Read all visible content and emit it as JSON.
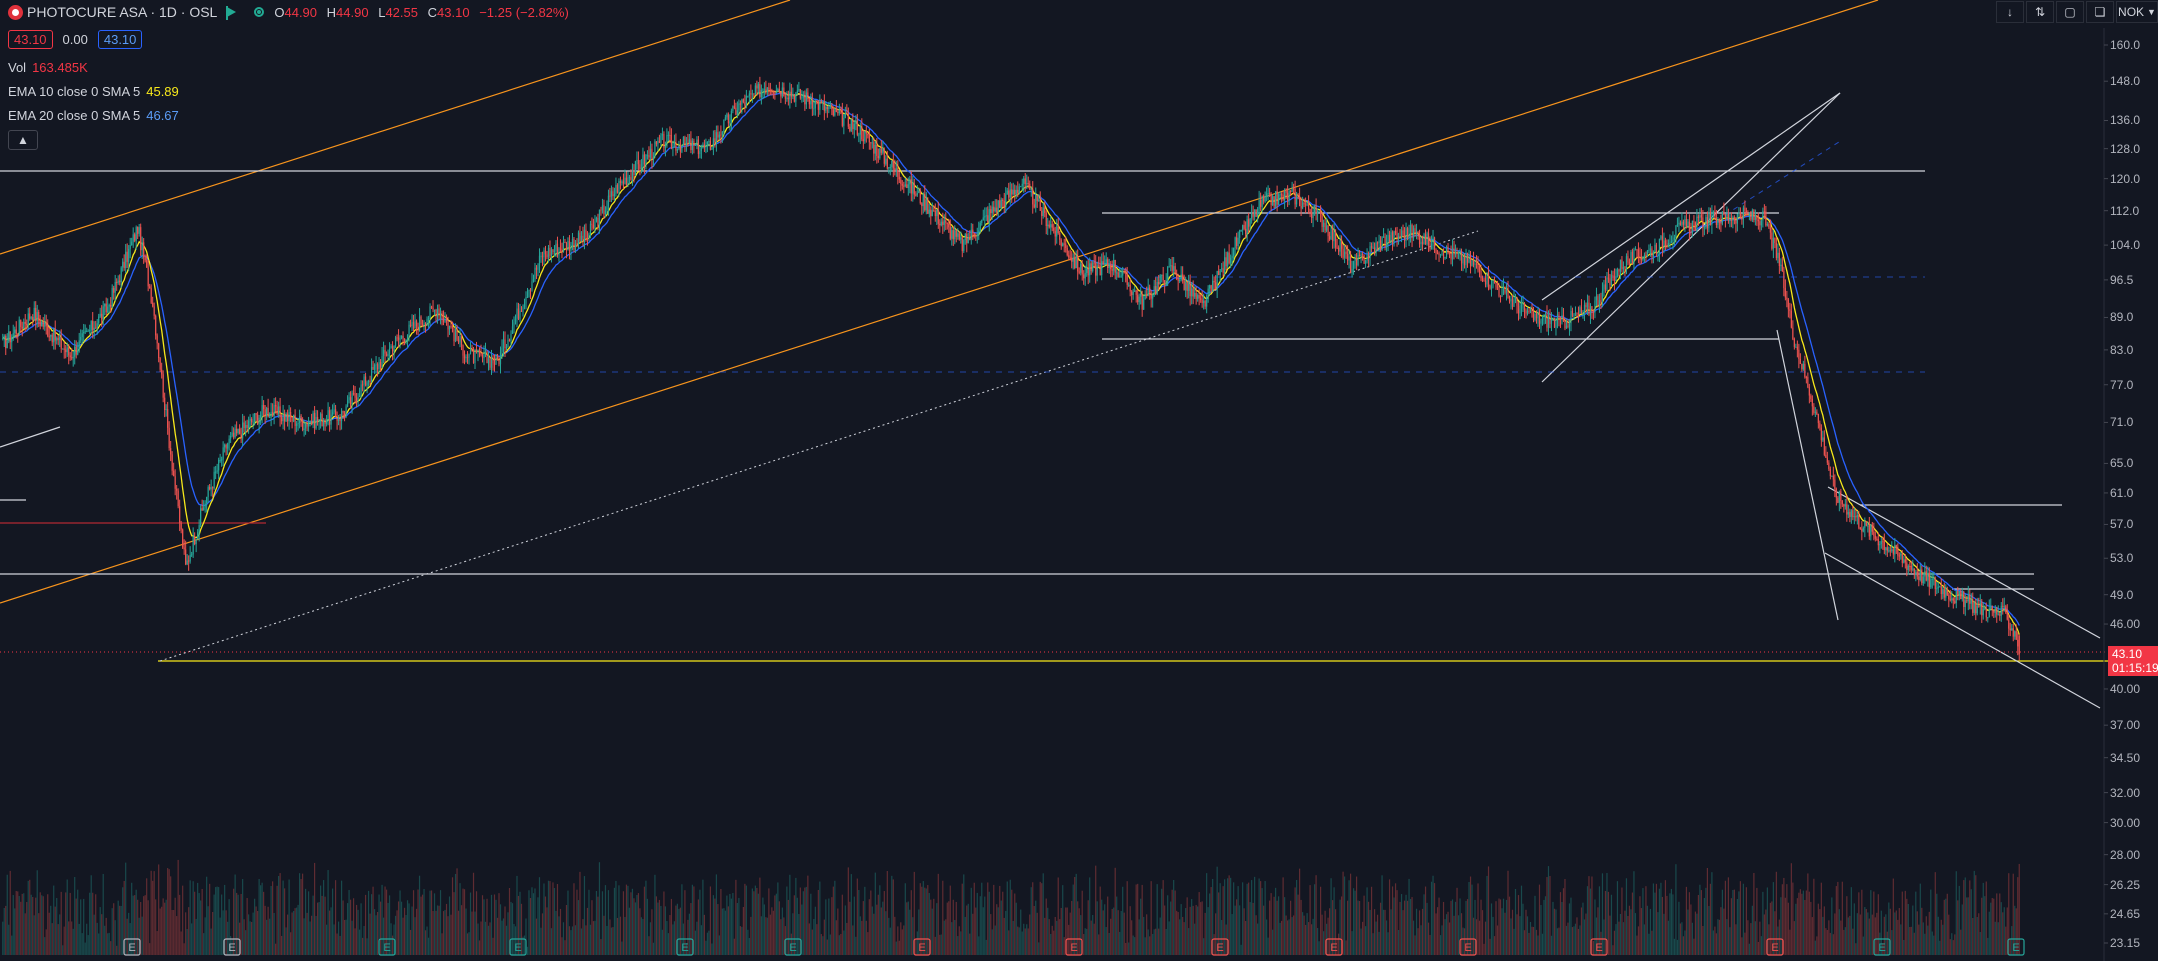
{
  "header": {
    "symbol_title": "PHOTOCURE ASA · 1D · OSL",
    "ohlc": [
      {
        "key": "O",
        "value": "44.90"
      },
      {
        "key": "H",
        "value": "44.90"
      },
      {
        "key": "L",
        "value": "42.55"
      },
      {
        "key": "C",
        "value": "43.10"
      }
    ],
    "change": "−1.25 (−2.82%)",
    "sell_price": "43.10",
    "spread": "0.00",
    "buy_price": "43.10"
  },
  "indicators": [
    {
      "label": "Vol",
      "value": "163.485K",
      "color": "#f23645"
    },
    {
      "label": "EMA 10 close 0 SMA 5",
      "value": "45.89",
      "color": "#f7e81b"
    },
    {
      "label": "EMA 20 close 0 SMA 5",
      "value": "46.67",
      "color": "#2962ff"
    }
  ],
  "toolbar": {
    "collapse_icon": "chevron-up-icon",
    "currency": "NOK"
  },
  "current_price": {
    "value": "43.10",
    "countdown": "01:15:19"
  },
  "colors": {
    "up": "#26a69a",
    "down": "#ef5350",
    "background": "#131722",
    "ema10": "#f7e81b",
    "ema20": "#2962ff",
    "orange_line": "#f7941d"
  },
  "chart_data": {
    "type": "candlestick",
    "symbol": "PHOTOCURE ASA",
    "interval": "1D",
    "y_scale": "log",
    "ylim": [
      23.15,
      160.0
    ],
    "y_ticks": [
      "160.0",
      "148.0",
      "136.0",
      "128.0",
      "120.0",
      "112.0",
      "104.0",
      "96.5",
      "89.0",
      "83.0",
      "77.0",
      "71.0",
      "65.0",
      "61.0",
      "57.0",
      "53.0",
      "49.0",
      "46.00",
      "43.10",
      "40.00",
      "37.00",
      "34.50",
      "32.00",
      "30.00",
      "28.00",
      "26.25",
      "24.65",
      "23.15"
    ],
    "close_path": [
      {
        "bar": 0,
        "close": 84
      },
      {
        "bar": 20,
        "close": 90
      },
      {
        "bar": 45,
        "close": 82
      },
      {
        "bar": 70,
        "close": 91
      },
      {
        "bar": 90,
        "close": 108
      },
      {
        "bar": 100,
        "close": 92
      },
      {
        "bar": 110,
        "close": 70
      },
      {
        "bar": 122,
        "close": 52
      },
      {
        "bar": 135,
        "close": 60
      },
      {
        "bar": 150,
        "close": 68
      },
      {
        "bar": 175,
        "close": 73
      },
      {
        "bar": 200,
        "close": 71
      },
      {
        "bar": 225,
        "close": 72
      },
      {
        "bar": 260,
        "close": 84
      },
      {
        "bar": 290,
        "close": 91
      },
      {
        "bar": 310,
        "close": 82
      },
      {
        "bar": 330,
        "close": 81
      },
      {
        "bar": 360,
        "close": 102
      },
      {
        "bar": 390,
        "close": 106
      },
      {
        "bar": 410,
        "close": 118
      },
      {
        "bar": 440,
        "close": 130
      },
      {
        "bar": 470,
        "close": 128
      },
      {
        "bar": 490,
        "close": 140
      },
      {
        "bar": 510,
        "close": 147
      },
      {
        "bar": 540,
        "close": 142
      },
      {
        "bar": 570,
        "close": 134
      },
      {
        "bar": 600,
        "close": 120
      },
      {
        "bar": 620,
        "close": 112
      },
      {
        "bar": 640,
        "close": 104
      },
      {
        "bar": 660,
        "close": 112
      },
      {
        "bar": 680,
        "close": 119
      },
      {
        "bar": 700,
        "close": 108
      },
      {
        "bar": 720,
        "close": 98
      },
      {
        "bar": 740,
        "close": 100
      },
      {
        "bar": 760,
        "close": 92
      },
      {
        "bar": 780,
        "close": 99
      },
      {
        "bar": 800,
        "close": 91
      },
      {
        "bar": 820,
        "close": 103
      },
      {
        "bar": 840,
        "close": 114
      },
      {
        "bar": 860,
        "close": 116
      },
      {
        "bar": 880,
        "close": 110
      },
      {
        "bar": 900,
        "close": 99
      },
      {
        "bar": 920,
        "close": 105
      },
      {
        "bar": 940,
        "close": 107
      },
      {
        "bar": 960,
        "close": 103
      },
      {
        "bar": 980,
        "close": 100
      },
      {
        "bar": 1000,
        "close": 94
      },
      {
        "bar": 1020,
        "close": 89
      },
      {
        "bar": 1040,
        "close": 88
      },
      {
        "bar": 1060,
        "close": 91
      },
      {
        "bar": 1080,
        "close": 100
      },
      {
        "bar": 1100,
        "close": 103
      },
      {
        "bar": 1120,
        "close": 108
      },
      {
        "bar": 1140,
        "close": 110
      },
      {
        "bar": 1160,
        "close": 111
      },
      {
        "bar": 1175,
        "close": 110
      },
      {
        "bar": 1185,
        "close": 100
      },
      {
        "bar": 1195,
        "close": 85
      },
      {
        "bar": 1210,
        "close": 72
      },
      {
        "bar": 1222,
        "close": 61
      },
      {
        "bar": 1240,
        "close": 57
      },
      {
        "bar": 1260,
        "close": 54
      },
      {
        "bar": 1280,
        "close": 51
      },
      {
        "bar": 1300,
        "close": 49
      },
      {
        "bar": 1320,
        "close": 47.5
      },
      {
        "bar": 1335,
        "close": 47
      },
      {
        "bar": 1343,
        "close": 44.9
      },
      {
        "bar": 1345,
        "close": 43.1
      }
    ],
    "last_bar": {
      "open": 44.9,
      "high": 44.9,
      "low": 42.55,
      "close": 43.1
    },
    "earnings_markers": [
      {
        "label": "E",
        "kind": "neutral"
      },
      {
        "label": "E",
        "kind": "neutral"
      },
      {
        "label": "E",
        "kind": "up"
      },
      {
        "label": "E",
        "kind": "up"
      },
      {
        "label": "E",
        "kind": "up"
      },
      {
        "label": "E",
        "kind": "up"
      },
      {
        "label": "E",
        "kind": "down"
      },
      {
        "label": "E",
        "kind": "down"
      },
      {
        "label": "E",
        "kind": "down"
      },
      {
        "label": "E",
        "kind": "down"
      },
      {
        "label": "E",
        "kind": "down"
      },
      {
        "label": "E",
        "kind": "down"
      },
      {
        "label": "E",
        "kind": "down"
      },
      {
        "label": "E",
        "kind": "up"
      },
      {
        "label": "E",
        "kind": "up"
      }
    ],
    "grid": false,
    "legend_placement": "top-left"
  }
}
